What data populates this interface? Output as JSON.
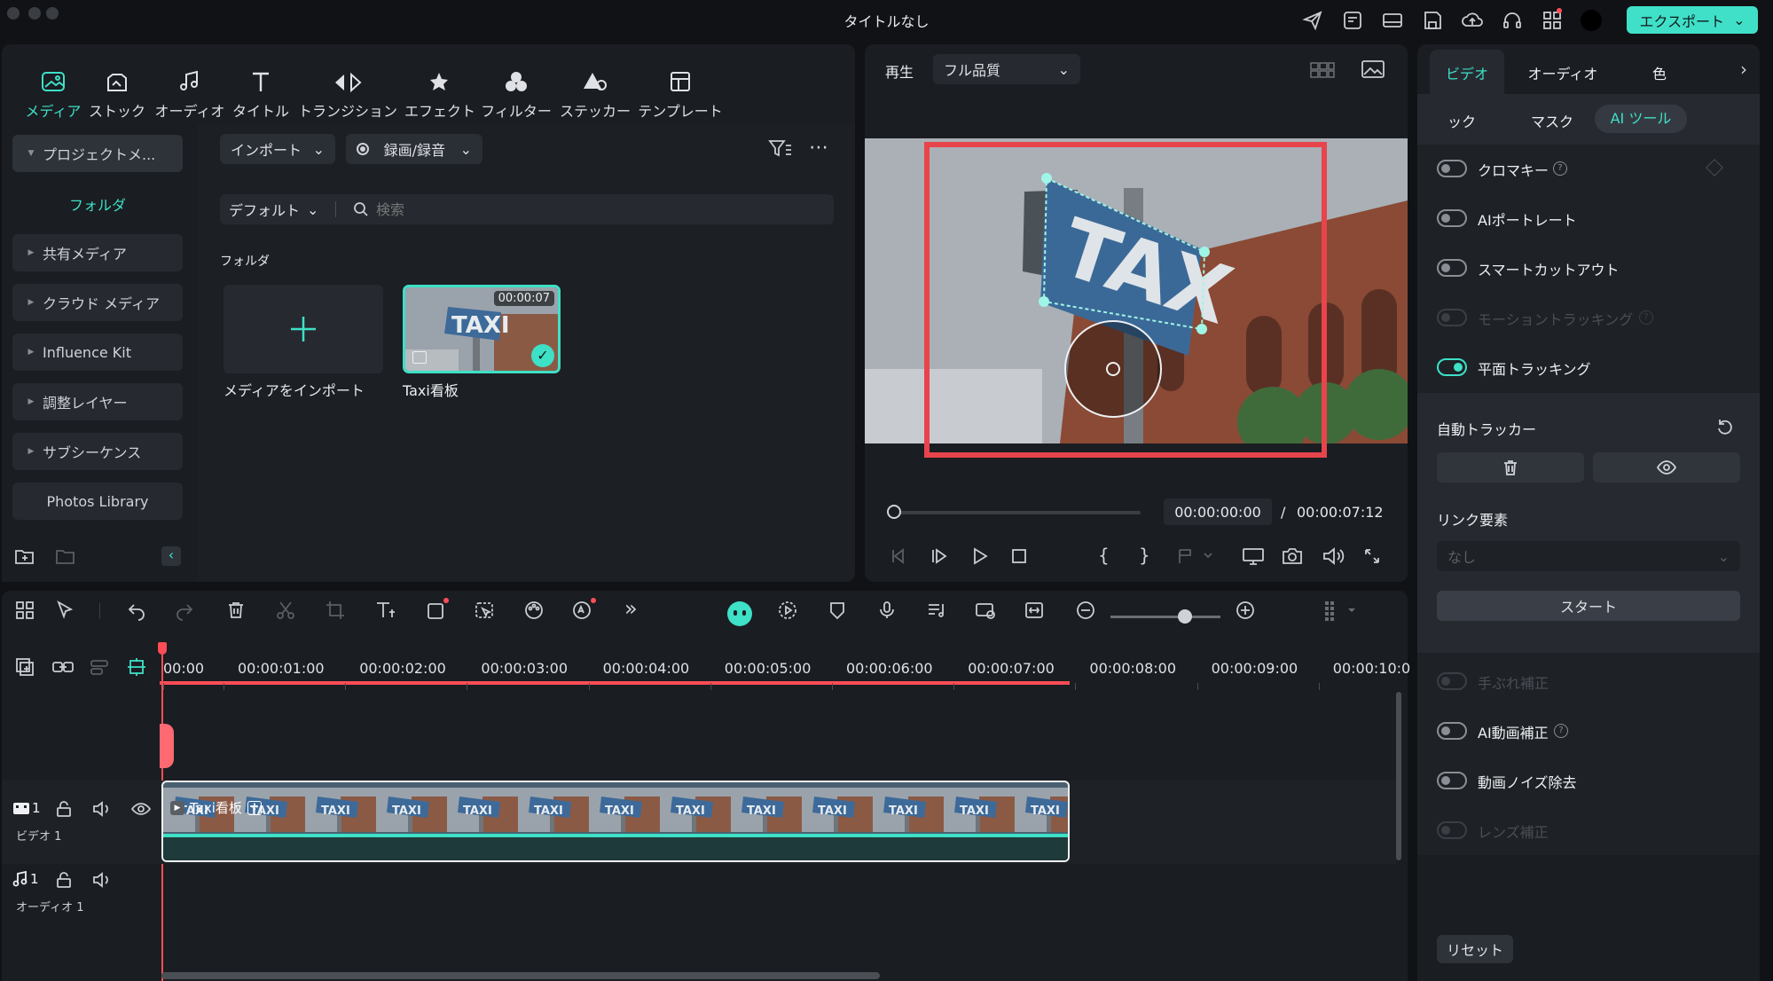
{
  "window": {
    "title": "タイトルなし",
    "export_label": "エクスポート"
  },
  "media_tabs": [
    {
      "label": "メディア",
      "icon": "media-icon"
    },
    {
      "label": "ストック",
      "icon": "stock-icon"
    },
    {
      "label": "オーディオ",
      "icon": "music-icon"
    },
    {
      "label": "タイトル",
      "icon": "title-icon"
    },
    {
      "label": "トランジション",
      "icon": "transition-icon"
    },
    {
      "label": "エフェクト",
      "icon": "effect-icon"
    },
    {
      "label": "フィルター",
      "icon": "filter-icon"
    },
    {
      "label": "ステッカー",
      "icon": "sticker-icon"
    },
    {
      "label": "テンプレート",
      "icon": "template-icon"
    }
  ],
  "sidebar": {
    "project_media": "プロジェクトメ...",
    "folder": "フォルダ",
    "items": [
      "共有メディア",
      "クラウド メディア",
      "Influence Kit",
      "調整レイヤー",
      "サブシーケンス"
    ],
    "photos_library": "Photos Library"
  },
  "media_area": {
    "import_label": "インポート",
    "record_label": "録画/録音",
    "sort_label": "デフォルト",
    "search_placeholder": "検索",
    "folder_heading": "フォルダ",
    "import_card_label": "メディアをインポート",
    "clip_name": "Taxi看板",
    "clip_duration": "00:00:07"
  },
  "preview": {
    "play_label": "再生",
    "quality": "フル品質",
    "sign_text": "TAX",
    "current_time": "00:00:00:00",
    "separator": "/",
    "total_time": "00:00:07:12"
  },
  "right_panel": {
    "tabs": [
      "ビデオ",
      "オーディオ",
      "色"
    ],
    "sub_tabs": [
      "ック",
      "マスク",
      "AI ツール"
    ],
    "toggles": [
      {
        "label": "クロマキー",
        "state": "off",
        "help": true
      },
      {
        "label": "AIポートレート",
        "state": "off"
      },
      {
        "label": "スマートカットアウト",
        "state": "off"
      },
      {
        "label": "モーショントラッキング",
        "state": "disabled",
        "help": true
      },
      {
        "label": "平面トラッキング",
        "state": "on"
      }
    ],
    "auto_tracker": "自動トラッカー",
    "link_element": "リンク要素",
    "link_value": "なし",
    "start_label": "スタート",
    "toggles2": [
      {
        "label": "手ぶれ補正",
        "state": "disabled"
      },
      {
        "label": "AI動画補正",
        "state": "off",
        "help": true
      },
      {
        "label": "動画ノイズ除去",
        "state": "off"
      },
      {
        "label": "レンズ補正",
        "state": "disabled"
      }
    ],
    "reset_label": "リセット"
  },
  "timeline": {
    "ruler": [
      "00:00",
      "00:00:01:00",
      "00:00:02:00",
      "00:00:03:00",
      "00:00:04:00",
      "00:00:05:00",
      "00:00:06:00",
      "00:00:07:00",
      "00:00:08:00",
      "00:00:09:00",
      "00:00:10:0"
    ],
    "video_track_num": "1",
    "video_track_name": "ビデオ 1",
    "audio_track_num": "1",
    "audio_track_name": "オーディオ 1",
    "clip_label": "Taxi看板",
    "frame_text": "TAXI"
  },
  "colors": {
    "accent": "#3ee0c6",
    "playhead": "#ff4d55",
    "highlight_box": "#e8444c"
  }
}
